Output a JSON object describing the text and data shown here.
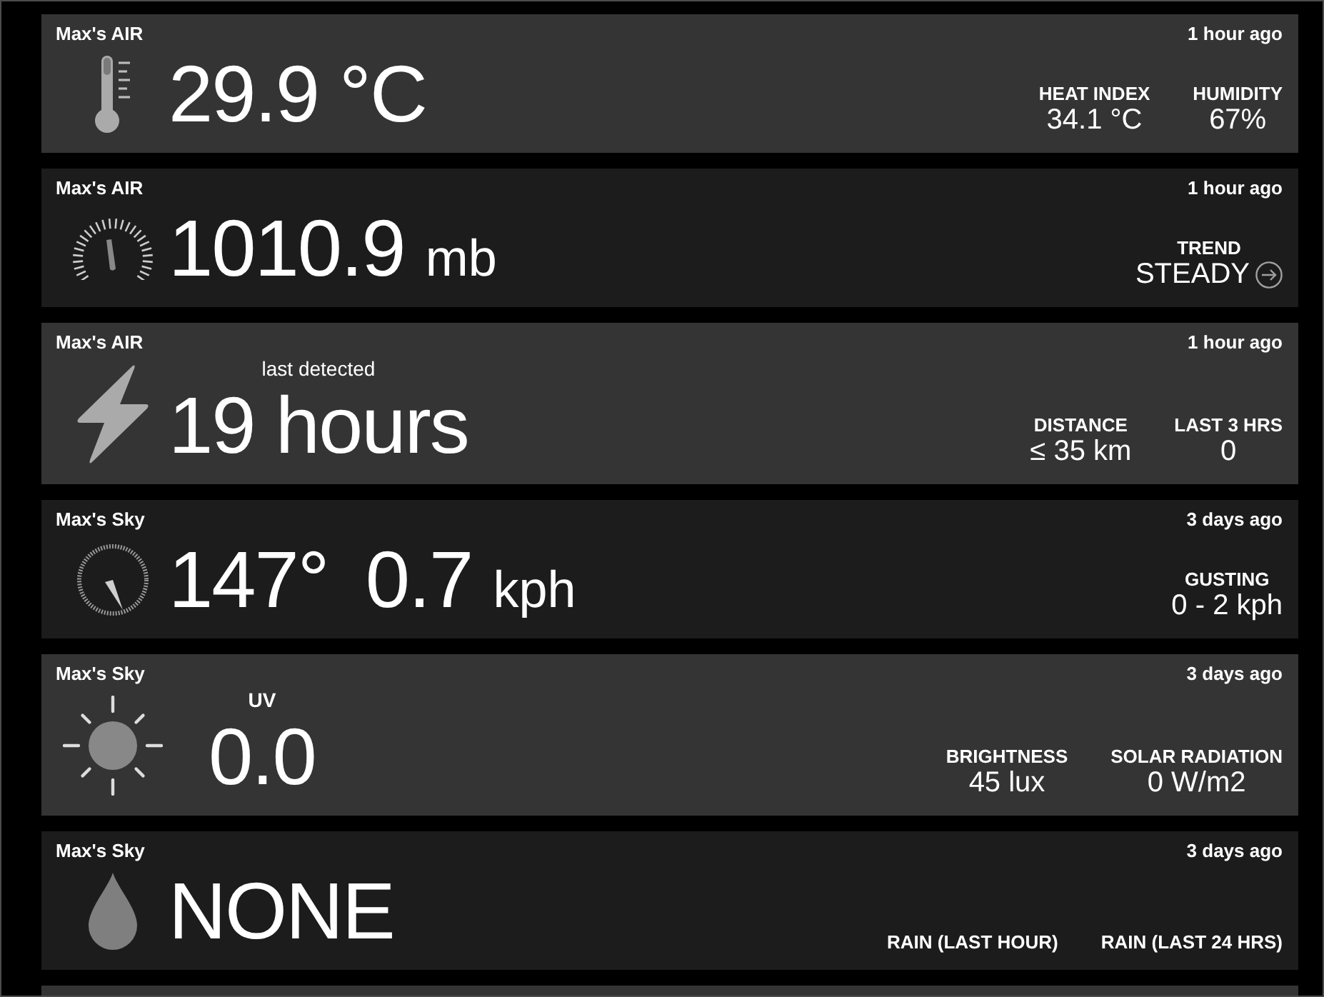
{
  "cards": [
    {
      "kind": "temperature",
      "device": "Max's AIR",
      "updated": "1 hour ago",
      "readings": [
        {
          "value": "29.9 °C"
        }
      ],
      "stats": [
        {
          "label": "HEAT INDEX",
          "value": "34.1 °C"
        },
        {
          "label": "HUMIDITY",
          "value": "67%"
        }
      ]
    },
    {
      "kind": "pressure",
      "device": "Max's AIR",
      "updated": "1 hour ago",
      "readings": [
        {
          "value": "1010.9",
          "unit": "mb"
        }
      ],
      "stats": [
        {
          "label": "TREND",
          "value": "STEADY"
        }
      ]
    },
    {
      "kind": "lightning",
      "device": "Max's AIR",
      "updated": "1 hour ago",
      "caption": "last detected",
      "readings": [
        {
          "value": "19 hours"
        }
      ],
      "stats": [
        {
          "label": "DISTANCE",
          "value": "≤ 35 km"
        },
        {
          "label": "LAST 3 HRS",
          "value": "0"
        }
      ]
    },
    {
      "kind": "wind",
      "device": "Max's Sky",
      "updated": "3 days ago",
      "readings": [
        {
          "value": "147°"
        },
        {
          "value": "0.7",
          "unit": "kph"
        }
      ],
      "stats": [
        {
          "label": "GUSTING",
          "value": "0 - 2 kph"
        }
      ]
    },
    {
      "kind": "uv",
      "device": "Max's Sky",
      "updated": "3 days ago",
      "caption": "UV",
      "readings": [
        {
          "value": "0.0"
        }
      ],
      "stats": [
        {
          "label": "BRIGHTNESS",
          "value": "45 lux"
        },
        {
          "label": "SOLAR RADIATION",
          "value": "0 W/m2"
        }
      ]
    },
    {
      "kind": "rain",
      "device": "Max's Sky",
      "updated": "3 days ago",
      "readings": [
        {
          "value": "NONE"
        }
      ],
      "stats": [
        {
          "label": "RAIN (LAST HOUR)"
        },
        {
          "label": "RAIN (LAST 24 HRS)"
        }
      ]
    }
  ]
}
